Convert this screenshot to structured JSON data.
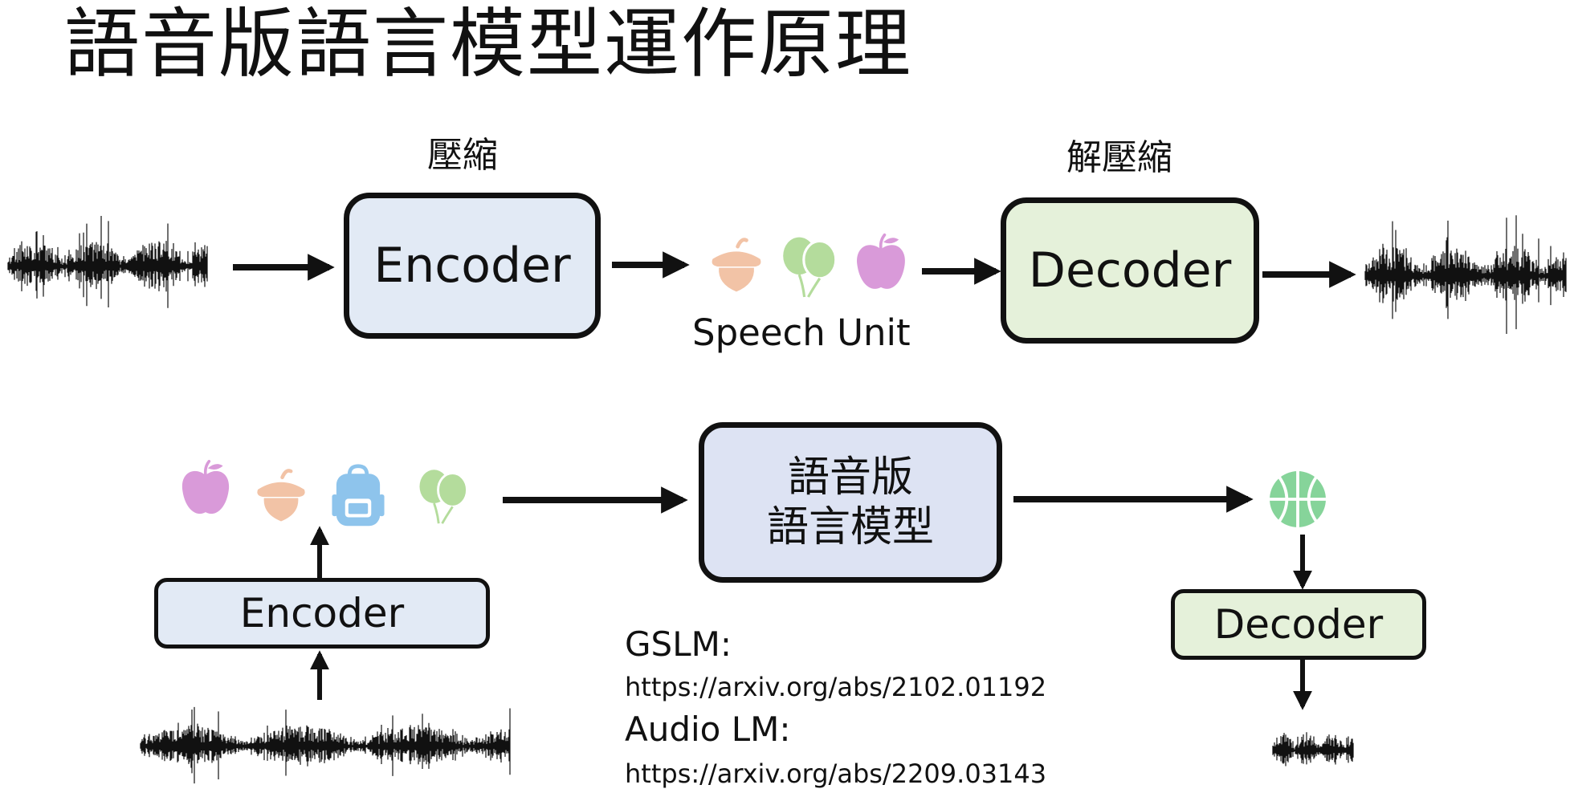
{
  "title": "語音版語言模型運作原理",
  "top": {
    "compress_label": "壓縮",
    "decompress_label": "解壓縮",
    "encoder_label": "Encoder",
    "decoder_label": "Decoder",
    "speech_unit_label": "Speech Unit"
  },
  "bottom": {
    "encoder_label": "Encoder",
    "lm_line1": "語音版",
    "lm_line2": "語言模型",
    "decoder_label": "Decoder"
  },
  "references": [
    {
      "name": "GSLM:",
      "url": "https://arxiv.org/abs/2102.01192"
    },
    {
      "name": "Audio LM:",
      "url": "https://arxiv.org/abs/2209.03143"
    }
  ],
  "icons": {
    "acorn": "acorn-icon",
    "balloons": "balloons-icon",
    "apple": "apple-icon",
    "backpack": "backpack-icon",
    "basketball": "basketball-icon"
  },
  "colors": {
    "encoder_fill": "#e2eaf5",
    "decoder_fill": "#e5f1da",
    "lm_fill": "#dde3f3",
    "acorn": "#f2c3a6",
    "balloons": "#b4dc9c",
    "apple": "#d99ad9",
    "backpack": "#8ec4ec",
    "basketball": "#86d49a"
  }
}
